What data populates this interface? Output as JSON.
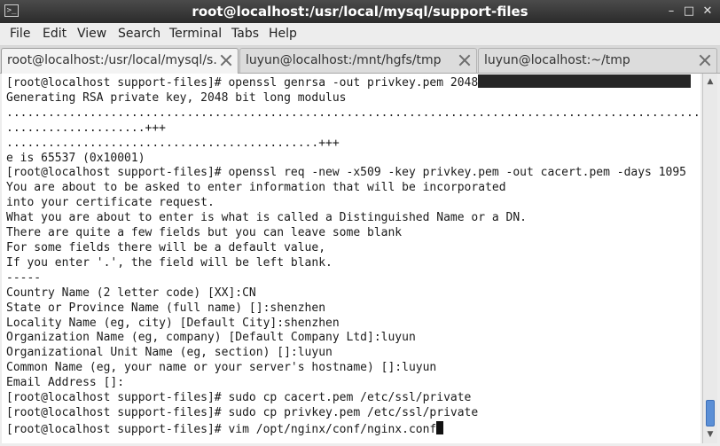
{
  "window": {
    "title": "root@localhost:/usr/local/mysql/support-files",
    "app_icon": "terminal-icon",
    "controls": {
      "minimize": "–",
      "maximize": "□",
      "close": "✕"
    }
  },
  "menubar": {
    "items": [
      "File",
      "Edit",
      "View",
      "Search",
      "Terminal",
      "Tabs",
      "Help"
    ]
  },
  "tabs": [
    {
      "label": "root@localhost:/usr/local/mysql/s...",
      "active": true
    },
    {
      "label": "luyun@localhost:/mnt/hgfs/tmp",
      "active": false
    },
    {
      "label": "luyun@localhost:~/tmp",
      "active": false
    }
  ],
  "terminal": {
    "lines": [
      "[root@localhost support-files]# openssl genrsa -out privkey.pem 2048",
      "Generating RSA private key, 2048 bit long modulus",
      ".........................................................................................................",
      "....................+++",
      ".............................................+++",
      "e is 65537 (0x10001)",
      "[root@localhost support-files]# openssl req -new -x509 -key privkey.pem -out cacert.pem -days 1095",
      "You are about to be asked to enter information that will be incorporated",
      "into your certificate request.",
      "What you are about to enter is what is called a Distinguished Name or a DN.",
      "There are quite a few fields but you can leave some blank",
      "For some fields there will be a default value,",
      "If you enter '.', the field will be left blank.",
      "-----",
      "Country Name (2 letter code) [XX]:CN",
      "State or Province Name (full name) []:shenzhen",
      "Locality Name (eg, city) [Default City]:shenzhen",
      "Organization Name (eg, company) [Default Company Ltd]:luyun",
      "Organizational Unit Name (eg, section) []:luyun",
      "Common Name (eg, your name or your server's hostname) []:luyun",
      "Email Address []:",
      "[root@localhost support-files]# sudo cp cacert.pem /etc/ssl/private",
      "[root@localhost support-files]# sudo cp privkey.pem /etc/ssl/private",
      "[root@localhost support-files]# vim /opt/nginx/conf/nginx.conf"
    ]
  },
  "scrollbar": {
    "position": 0.96
  }
}
